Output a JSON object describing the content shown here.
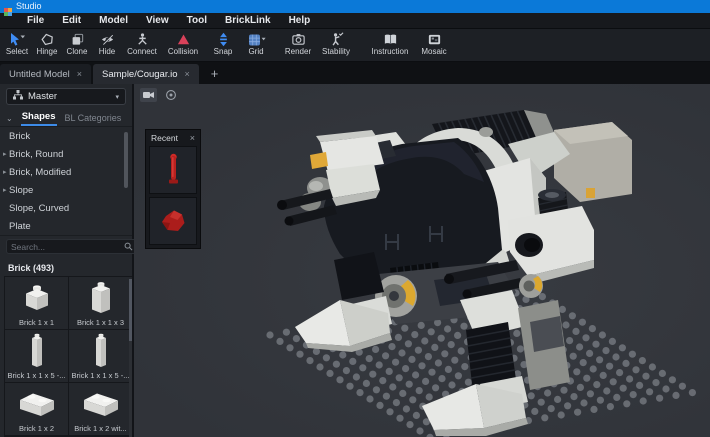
{
  "titlebar": {
    "app_title": "Studio"
  },
  "menubar": {
    "items": [
      {
        "label": "File"
      },
      {
        "label": "Edit"
      },
      {
        "label": "Model"
      },
      {
        "label": "View"
      },
      {
        "label": "Tool"
      },
      {
        "label": "BrickLink"
      },
      {
        "label": "Help"
      }
    ]
  },
  "toolbar": {
    "items": [
      {
        "label": "Select"
      },
      {
        "label": "Hinge"
      },
      {
        "label": "Clone"
      },
      {
        "label": "Hide"
      },
      {
        "label": "Connect"
      },
      {
        "label": "Collision"
      },
      {
        "label": "Snap"
      },
      {
        "label": "Grid"
      },
      {
        "label": "Render"
      },
      {
        "label": "Stability"
      },
      {
        "label": "Instruction"
      },
      {
        "label": "Mosaic"
      }
    ]
  },
  "tabstrip": {
    "tabs": [
      {
        "label": "Untitled Model",
        "close": "×"
      },
      {
        "label": "Sample/Cougar.io",
        "close": "×"
      }
    ],
    "add_button": "+"
  },
  "sidebar": {
    "master_dropdown": {
      "label": "Master",
      "caret": "▾"
    },
    "panel_tabs": {
      "chevron": "⌄",
      "shapes": "Shapes",
      "bl_categories": "BL Categories"
    },
    "categories": [
      {
        "label": "Brick"
      },
      {
        "label": "Brick, Round",
        "arrow": "▸"
      },
      {
        "label": "Brick, Modified",
        "arrow": "▸"
      },
      {
        "label": "Slope",
        "arrow": "▸"
      },
      {
        "label": "Slope, Curved"
      },
      {
        "label": "Plate"
      }
    ],
    "search": {
      "placeholder": "Search..."
    },
    "results_header": "Brick (493)",
    "bricks": [
      {
        "label": "Brick 1 x 1"
      },
      {
        "label": "Brick 1 x 1 x 3"
      },
      {
        "label": "Brick 1 x 1 x 5 -..."
      },
      {
        "label": "Brick 1 x 1 x 5 -..."
      },
      {
        "label": "Brick 1 x 2"
      },
      {
        "label": "Brick 1 x 2 wit..."
      }
    ]
  },
  "viewport": {
    "recent_panel": {
      "title": "Recent",
      "close": "×",
      "items": [
        {
          "name": "red-antenna"
        },
        {
          "name": "red-boulder"
        }
      ]
    }
  },
  "colors": {
    "titlebar_blue": "#0b79d8",
    "accent_blue": "#3d8be8",
    "collision_red": "#d9415a",
    "accent_yellow": "#e0a838"
  }
}
